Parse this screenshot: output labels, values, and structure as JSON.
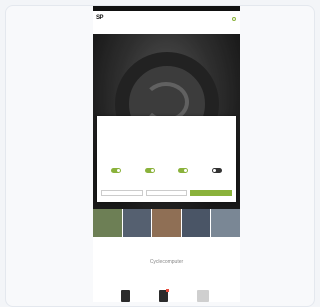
{
  "colors": {
    "accent": "#8ab23b",
    "badge": "#e74b3c",
    "hero_dark": "#1f1f1f"
  },
  "site": {
    "logo": "SP",
    "topstrip": "",
    "nav": [
      "",
      "",
      "",
      ""
    ],
    "util": [
      "",
      ""
    ],
    "subrow": [
      ""
    ],
    "badge": ""
  },
  "consent": {
    "title": "",
    "logo": "",
    "body": "",
    "toggles": [
      {
        "label": "",
        "on": true
      },
      {
        "label": "",
        "on": true
      },
      {
        "label": "",
        "on": true
      },
      {
        "label": "",
        "on": false
      }
    ],
    "buttons": [
      "",
      "",
      ""
    ]
  },
  "thumbs": [
    {
      "label": "",
      "color": "#6d7f55"
    },
    {
      "label": "",
      "color": "#556070"
    },
    {
      "label": "",
      "color": "#8f6f55"
    },
    {
      "label": "",
      "color": "#4a5566"
    },
    {
      "label": "",
      "color": "#7a8795"
    }
  ],
  "section": {
    "title": "Cyclecomputer"
  }
}
